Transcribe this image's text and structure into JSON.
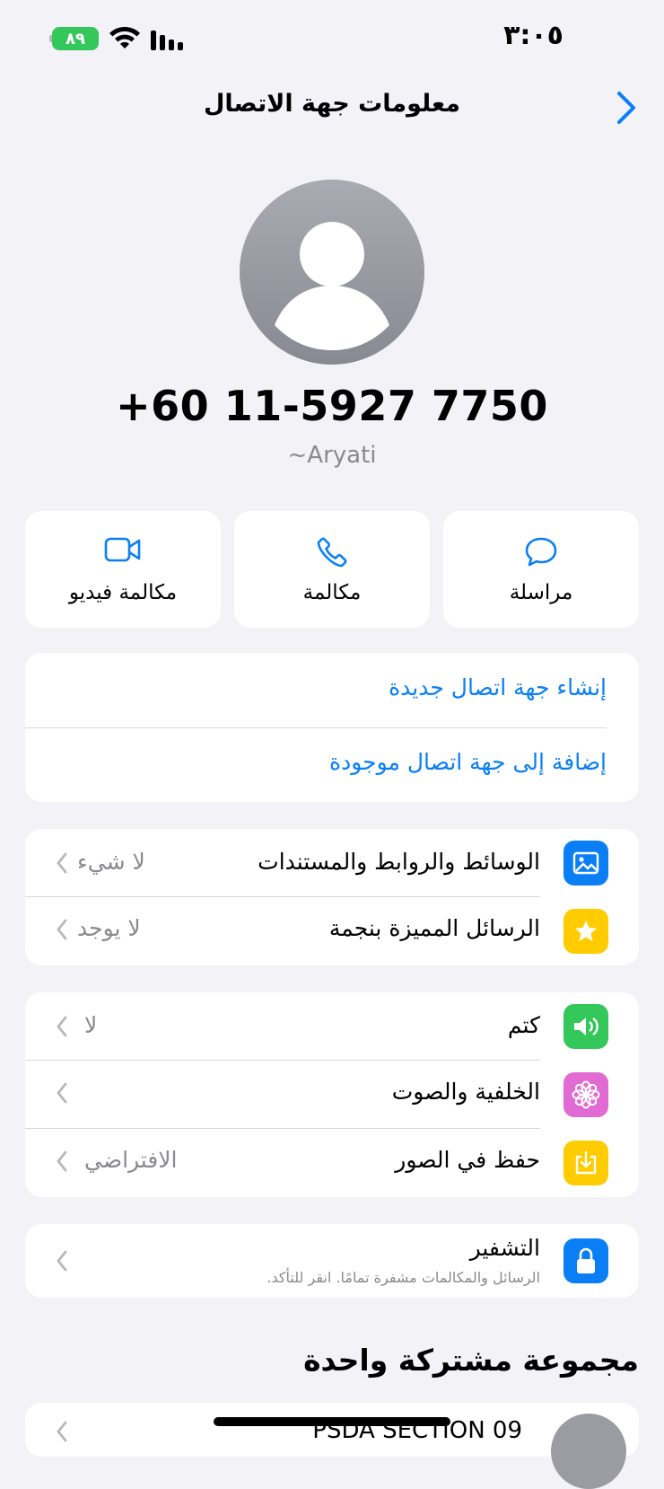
{
  "status_bar": {
    "time": "٣:٠٥",
    "battery": "٨٩"
  },
  "nav": {
    "title": "معلومات جهة الاتصال"
  },
  "contact": {
    "number": "+60 11-5927 7750",
    "alias": "~Aryati"
  },
  "actions": {
    "message": "مراسلة",
    "call": "مكالمة",
    "video": "مكالمة فيديو"
  },
  "contact_options": {
    "create": "إنشاء جهة اتصال جديدة",
    "add_existing": "إضافة إلى جهة اتصال موجودة"
  },
  "media_group": {
    "media_label": "الوسائط والروابط والمستندات",
    "media_value": "لا شيء",
    "starred_label": "الرسائل المميزة بنجمة",
    "starred_value": "لا يوجد"
  },
  "settings_group": {
    "mute_label": "كتم",
    "mute_value": "لا",
    "wallpaper_label": "الخلفية والصوت",
    "save_label": "حفظ في الصور",
    "save_value": "الافتراضي"
  },
  "encryption": {
    "title": "التشفير",
    "subtitle": "الرسائل والمكالمات مشفرة تمامًا. انقر للتأكد."
  },
  "groups": {
    "header": "مجموعة مشتركة واحدة",
    "first_name": "PSDA SECTION 09"
  },
  "colors": {
    "accent": "#0a7ff5",
    "green": "#34c759",
    "yellow": "#ffcc00",
    "pink": "#e26ad3",
    "blue_tile": "#0a7ff5"
  },
  "icons": [
    "chevron-back-icon",
    "person-placeholder-icon",
    "message-icon",
    "phone-icon",
    "video-icon",
    "photo-icon",
    "star-icon",
    "speaker-icon",
    "flower-icon",
    "download-icon",
    "lock-icon"
  ]
}
